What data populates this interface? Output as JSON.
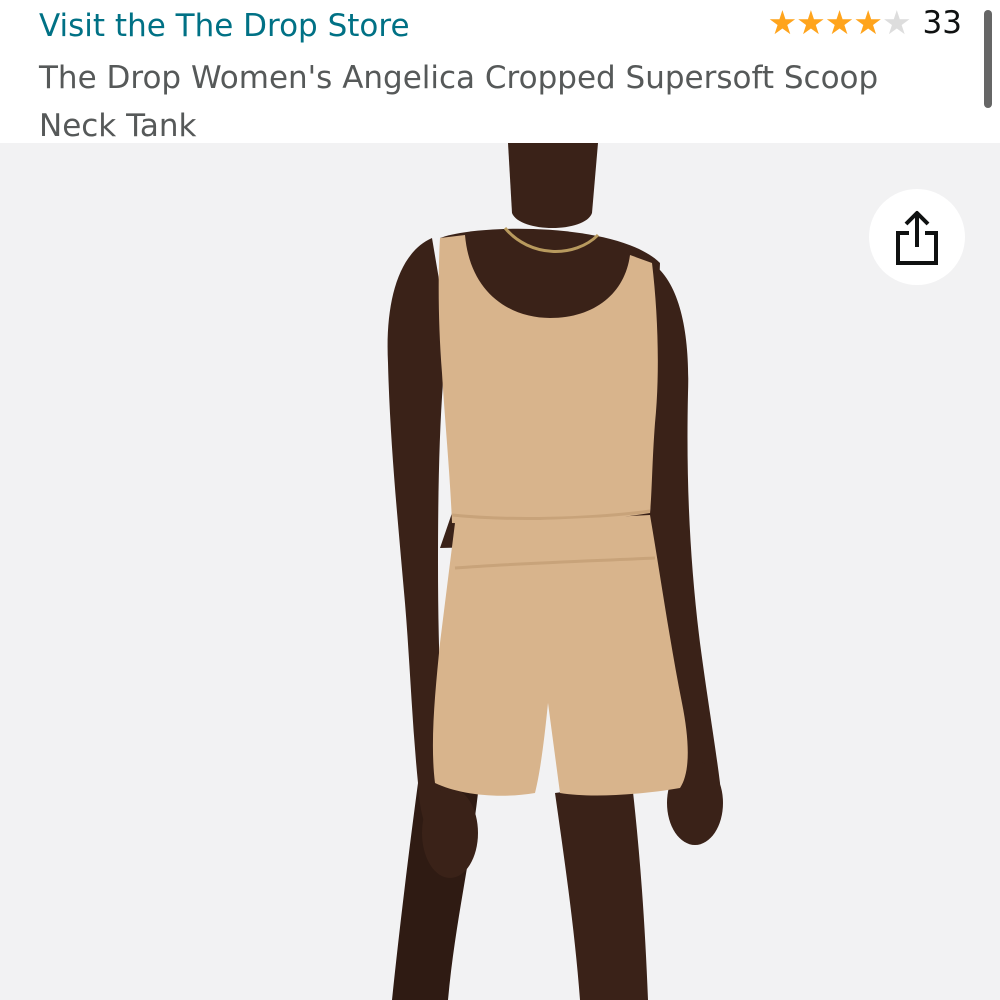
{
  "header": {
    "store_link": "Visit the The Drop Store",
    "product_title": "The Drop Women's Angelica Cropped Supersoft Scoop Neck Tank",
    "rating": {
      "stars": 4,
      "max": 5,
      "count": "33"
    }
  },
  "image": {
    "share_icon": "share-icon",
    "colors": {
      "skin": "#3a2218",
      "garment": "#d8b48c",
      "background": "#f2f2f3"
    }
  },
  "colors": {
    "link": "#007185",
    "title": "#565959",
    "star": "#FFA41C"
  }
}
